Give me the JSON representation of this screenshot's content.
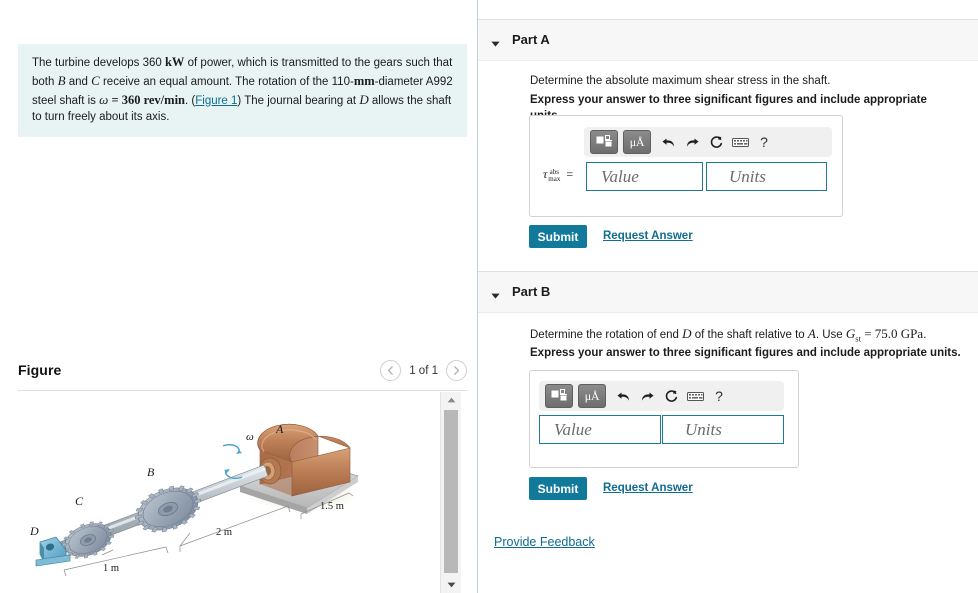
{
  "problem": {
    "text_part1": "The turbine develops 360 ",
    "unit_kw": "kW",
    "text_part2": " of power, which is transmitted to the gears such that both ",
    "var_b": "B",
    "text_part3": " and ",
    "var_c": "C",
    "text_part4": " receive an equal amount. The rotation of the 110-",
    "unit_mm": "mm",
    "text_part5": "-diameter A992 steel shaft is ",
    "omega": "ω",
    "eq": " = ",
    "rpm_value": "360 rev/min",
    "text_part6": ". (",
    "figure_link": "Figure 1",
    "text_part7": ") The journal bearing at ",
    "var_d": "D",
    "text_part8": " allows the shaft to turn freely about its axis."
  },
  "figure": {
    "title": "Figure",
    "counter": "1 of 1",
    "prev_label": "previous-figure",
    "next_label": "next-figure",
    "labels": {
      "a": "A",
      "b": "B",
      "c": "C",
      "d": "D",
      "omega": "ω",
      "dim_1_5": "1.5 m",
      "dim_2": "2 m",
      "dim_1": "1 m"
    },
    "colors": {
      "turbine_body": "#b5764f",
      "turbine_base": "#c9c9c9",
      "shaft": "#b0b6bb",
      "gear": "#9aa6b4",
      "bearing": "#6fb2cf"
    }
  },
  "parts": [
    {
      "id": "part-a",
      "title": "Part A",
      "question_prefix": "Determine the absolute maximum shear stress in the shaft.",
      "instruction": "Express your answer to three significant figures and include appropriate units.",
      "answer_label_tau": "τ",
      "answer_label_sub_top": "abs",
      "answer_label_sub_bottom": "max",
      "answer_label_eq": "=",
      "value_placeholder": "Value",
      "units_placeholder": "Units",
      "value_current": "",
      "units_current": "",
      "submit_label": "Submit",
      "request_answer_label": "Request Answer"
    },
    {
      "id": "part-b",
      "title": "Part B",
      "q_t1": "Determine the rotation of end ",
      "q_var_d": "D",
      "q_t2": " of the shaft relative to ",
      "q_var_a": "A",
      "q_t3": ". Use ",
      "q_gst": "G",
      "q_gst_sub": "st",
      "q_t4": " = 75.0 GPa",
      "q_t5": ".",
      "instruction": "Express your answer to three significant figures and include appropriate units.",
      "value_placeholder": "Value",
      "units_placeholder": "Units",
      "value_current": "",
      "units_current": "",
      "submit_label": "Submit",
      "request_answer_label": "Request Answer"
    }
  ],
  "toolbar": {
    "template_icon": "math-template-icon",
    "units_icon": "μÅ",
    "undo_icon": "undo-icon",
    "redo_icon": "redo-icon",
    "reset_icon": "reset-icon",
    "keyboard_icon": "keyboard-icon",
    "help_icon": "?"
  },
  "footer": {
    "provide_feedback": "Provide Feedback"
  },
  "colors": {
    "accent_teal": "#11799a",
    "link_blue": "#0f6c92",
    "statement_bg": "#e7f4f3",
    "part_header_bg": "#f7f7f7",
    "field_border": "#1c7a96"
  }
}
